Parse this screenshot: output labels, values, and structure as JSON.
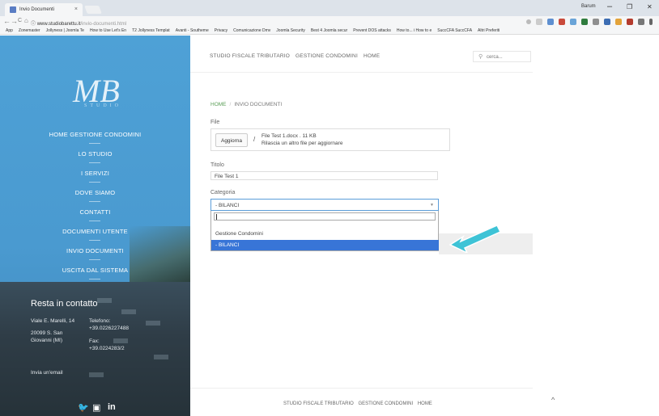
{
  "browser": {
    "tab_title": "Invio Documenti",
    "tab_close": "×",
    "user": "Barum",
    "min": "–",
    "restore": "❐",
    "close": "✕",
    "back": "←",
    "forward": "→",
    "reload": "C",
    "home": "⌂",
    "info": "ⓘ",
    "url_host": "www.studiobarettu.it",
    "url_path": "/invio-documenti.html",
    "bookmarks": [
      "App",
      "Zonemaster",
      "Jollyness | Joomla Te",
      "How to Use Let's En",
      "T2 Jollyness Templat",
      "Avanti - Southeme",
      "Privacy",
      "Comunicazione Dmv",
      "Joomla Security",
      "Best 4 Joomla secur",
      "Prevent DOS attacks",
      "How to... i How to e",
      "SuccCFA SuccCFA",
      "Altri Preferiti"
    ]
  },
  "sidebar": {
    "logo_text": "MB",
    "logo_sub": "STUDIO",
    "menu": [
      "HOME GESTIONE CONDOMINI",
      "LO STUDIO",
      "I SERVIZI",
      "DOVE SIAMO",
      "CONTATTI",
      "DOCUMENTI UTENTE",
      "INVIO DOCUMENTI",
      "USCITA DAL SISTEMA"
    ],
    "contact_title": "Resta in contatto",
    "address_line1": "Viale E. Marelli, 14",
    "address_line2": "20099  S. San",
    "address_line3": "Giovanni (MI)",
    "phone_label": "Telefono:",
    "phone": "+39.0226227488",
    "fax_label": "Fax:",
    "fax": "+39.0224283/2",
    "email_link": "Invia un'email",
    "social": [
      "🐦",
      "▣",
      "in"
    ]
  },
  "header": {
    "nav": [
      "STUDIO FISCALE TRIBUTARIO",
      "GESTIONE CONDOMINI",
      "HOME"
    ],
    "search_placeholder": "cerca...",
    "search_icon": "⚲"
  },
  "breadcrumb": {
    "home": "HOME",
    "sep": "/",
    "current": "INVIO DOCUMENTI"
  },
  "form": {
    "file_label": "File",
    "file_button": "Aggiorna",
    "file_slash": "/",
    "file_name": "File Test 1.docx . 11 KB",
    "file_hint": "Rilascia un altro file per aggiornare",
    "title_label": "Titolo",
    "title_value": "File Test 1",
    "category_label": "Categoria",
    "category_selected": "- BILANCI",
    "caret": "▼",
    "options": [
      "Gestione Condomini",
      "- BILANCI"
    ]
  },
  "footer": {
    "nav": [
      "STUDIO FISCALE TRIBUTARIO",
      "GESTIONE CONDOMINI",
      "HOME"
    ],
    "up_icon": "^"
  },
  "colors": {
    "sidebar_blue": "#4ea1d6",
    "selected_option": "#3875d7",
    "breadcrumb_green": "#5a9e56",
    "arrow_teal": "#3ec3d6"
  }
}
